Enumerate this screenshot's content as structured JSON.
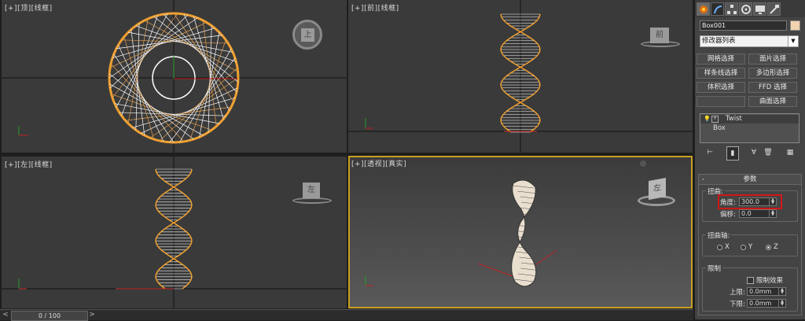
{
  "viewports": {
    "top": {
      "label": "[+][顶][线框]"
    },
    "front": {
      "label": "[+][前][线框]"
    },
    "left": {
      "label": "[+][左][线框]"
    },
    "perspective": {
      "label": "[+][透视][真实]"
    }
  },
  "viewcube": {
    "top_face": "上",
    "front_face": "前",
    "left_face": "左",
    "persp_face": "左"
  },
  "timeline": {
    "prev": "<",
    "slider": "0 / 100",
    "next": ">"
  },
  "command_panel": {
    "tabs": [
      "create-icon",
      "modify-icon",
      "hierarchy-icon",
      "motion-icon",
      "display-icon",
      "utilities-icon"
    ],
    "object_name": "Box001",
    "object_color": "#f2d3b0",
    "modifier_list": "修改器列表",
    "buttons": {
      "mesh_select": "网格选择",
      "patch_select": "面片选择",
      "spline_select": "样条线选择",
      "poly_select": "多边形选择",
      "vol_select": "体积选择",
      "ffd_select": "FFD 选择",
      "surf_select": "曲面选择"
    },
    "stack": {
      "modifier": "Twist",
      "base": "Box"
    },
    "rollout_title": "参数",
    "rollout_minus": "-",
    "twist_group": "扭曲:",
    "angle_label": "角度:",
    "angle_value": "300.0",
    "bias_label": "偏移:",
    "bias_value": "0.0",
    "axis_group": "扭曲轴:",
    "axis_x": "X",
    "axis_y": "Y",
    "axis_z": "Z",
    "limits_group": "限制",
    "limit_effect": "限制效果",
    "upper_label": "上限:",
    "upper_value": "0.0mm",
    "lower_label": "下限:",
    "lower_value": "0.0mm"
  }
}
